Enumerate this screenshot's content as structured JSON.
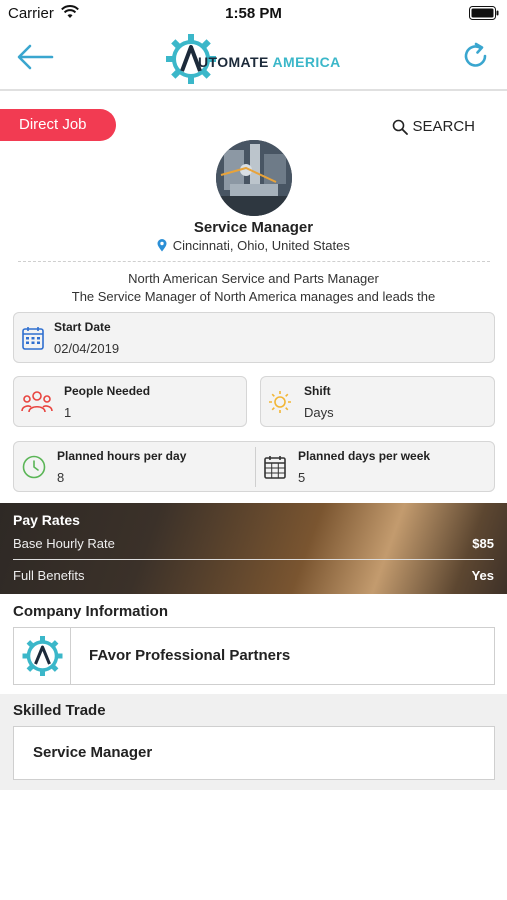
{
  "status_bar": {
    "carrier": "Carrier",
    "time": "1:58 PM"
  },
  "header": {
    "logo_part1": "UTOMATE",
    "logo_part2": "AMERICA",
    "logo_initial": "A",
    "brand_color": "#3bb7c9"
  },
  "badge": {
    "label": "Direct Job",
    "color": "#f23b52"
  },
  "search": {
    "label": "SEARCH"
  },
  "job": {
    "title": "Service Manager",
    "location": "Cincinnati, Ohio, United States",
    "description_line1": "North American Service and Parts Manager",
    "description_line2": "The Service Manager of North America manages and leads the"
  },
  "details": {
    "start_date": {
      "label": "Start Date",
      "value": "02/04/2019",
      "icon": "calendar-icon"
    },
    "people_needed": {
      "label": "People Needed",
      "value": "1",
      "icon": "people-icon"
    },
    "shift": {
      "label": "Shift",
      "value": "Days",
      "icon": "sun-icon"
    },
    "hours_per_day": {
      "label": "Planned hours per day",
      "value": "8",
      "icon": "clock-icon"
    },
    "days_per_week": {
      "label": "Planned days per week",
      "value": "5",
      "icon": "calendar-grid-icon"
    }
  },
  "pay_rates": {
    "title": "Pay Rates",
    "rows": [
      {
        "label": "Base Hourly Rate",
        "value": "$85"
      },
      {
        "label": "Full Benefits",
        "value": "Yes"
      }
    ]
  },
  "company": {
    "section_title": "Company Information",
    "name": "FAvor Professional Partners"
  },
  "skilled_trade": {
    "section_title": "Skilled Trade",
    "name": "Service Manager"
  }
}
